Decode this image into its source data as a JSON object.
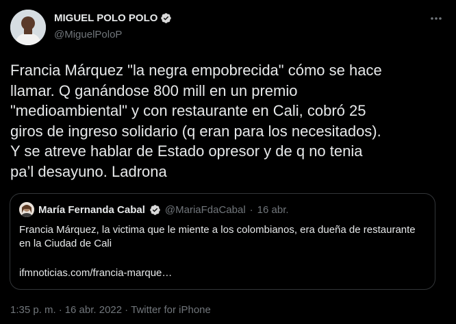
{
  "author": {
    "name": "MIGUEL POLO POLO",
    "handle": "@MiguelPoloP",
    "verified_color": "#d9d9d9"
  },
  "tweet": {
    "text": "Francia Márquez \"la negra empobrecida\" cómo se hace\nllamar. Q ganándose 800 mill en un premio\n\"medioambiental\" y con restaurante en Cali, cobró 25\ngiros de ingreso solidario (q eran para los necesitados).\nY se atreve hablar de Estado opresor y de q no tenia\npa’l desayuno. Ladrona"
  },
  "quote": {
    "name": "María Fernanda Cabal",
    "handle": "@MariaFdaCabal",
    "separator": "·",
    "date": "16 abr.",
    "text": "Francia Márquez, la victima que le miente a los colombianos, era dueña de restaurante en la Ciudad de Cali",
    "link": "ifmnoticias.com/francia-marque…"
  },
  "meta": {
    "time": "1:35 p. m.",
    "separator1": "·",
    "date": "16 abr. 2022",
    "separator2": "·",
    "source": "Twitter for iPhone"
  },
  "icons": {
    "more": "more-icon",
    "verified": "verified-icon"
  },
  "colors": {
    "background": "#000000",
    "text": "#e7e9ea",
    "secondary": "#71767b",
    "border": "#333639"
  }
}
